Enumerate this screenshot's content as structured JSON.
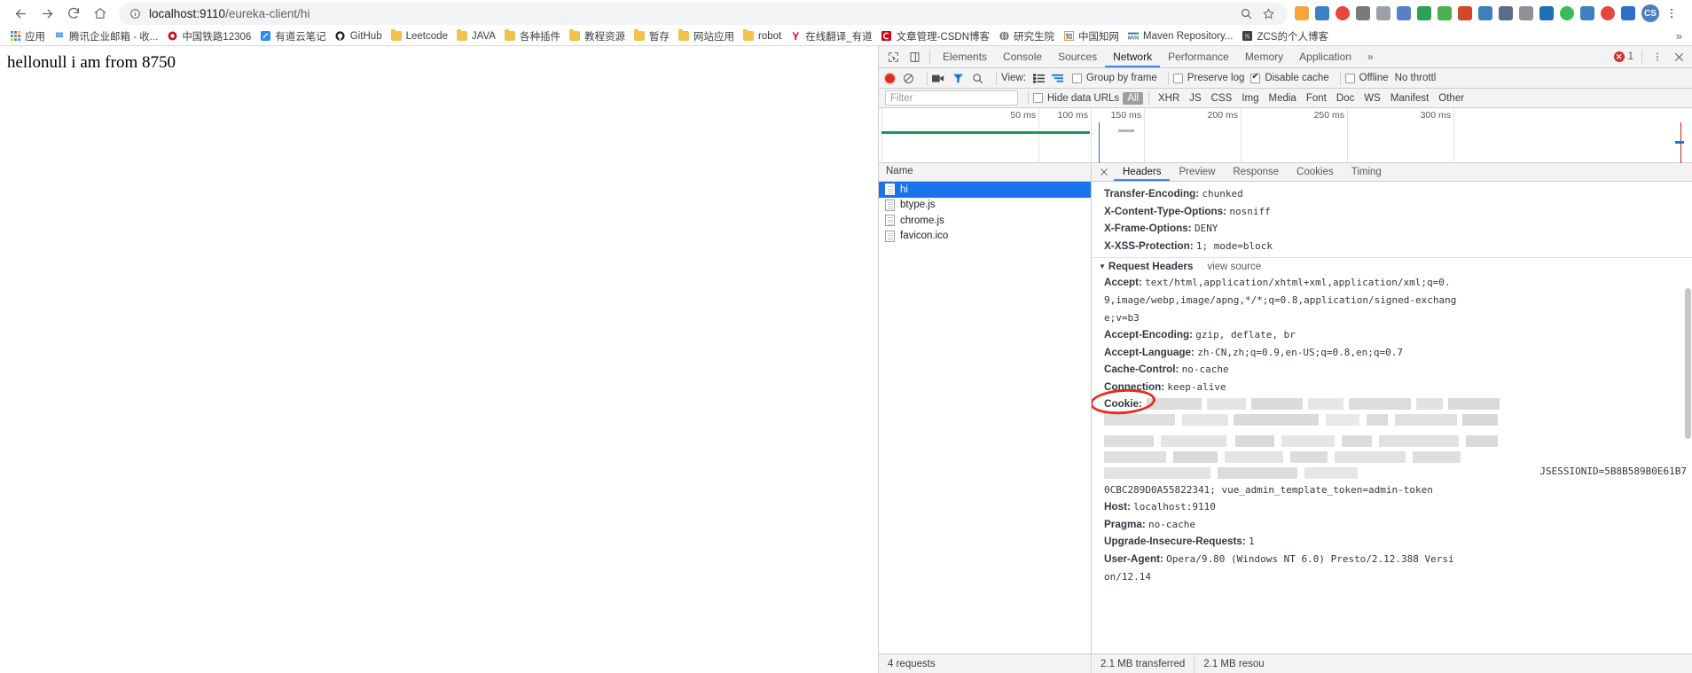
{
  "browser": {
    "nav": {
      "back": "back-arrow",
      "forward": "forward-arrow",
      "reload": "reload",
      "home": "home"
    },
    "omnibox": {
      "security_icon": "info-circle-icon",
      "url_host": "localhost:9110",
      "url_path": "/eureka-client/hi",
      "full_url": "localhost:9110/eureka-client/hi",
      "zoom_icon": "zoom-search-icon",
      "star_icon": "bookmark-star-icon"
    },
    "profile_initials": "CS",
    "bookmarks": [
      {
        "label": "应用",
        "icon": "apps-grid-icon",
        "color": "#4285f4"
      },
      {
        "label": "腾讯企业邮箱 - 收...",
        "icon": "mail-icon",
        "color": "#2a7fe0"
      },
      {
        "label": "中国铁路12306",
        "icon": "railway-icon",
        "color": "#c8102e"
      },
      {
        "label": "有道云笔记",
        "icon": "note-icon",
        "color": "#2d8cf0"
      },
      {
        "label": "GitHub",
        "icon": "github-icon",
        "color": "#1b1f23"
      },
      {
        "label": "Leetcode",
        "icon": "folder-icon",
        "color": "#f2c14e"
      },
      {
        "label": "JAVA",
        "icon": "folder-icon",
        "color": "#f2c14e"
      },
      {
        "label": "各种插件",
        "icon": "folder-icon",
        "color": "#f2c14e"
      },
      {
        "label": "教程资源",
        "icon": "folder-icon",
        "color": "#f2c14e"
      },
      {
        "label": "暂存",
        "icon": "folder-icon",
        "color": "#f2c14e"
      },
      {
        "label": "网站应用",
        "icon": "folder-icon",
        "color": "#f2c14e"
      },
      {
        "label": "robot",
        "icon": "folder-icon",
        "color": "#f2c14e"
      },
      {
        "label": "在线翻译_有道",
        "icon": "youdao-icon",
        "color": "#d0021b"
      },
      {
        "label": "文章管理-CSDN博客",
        "icon": "csdn-icon",
        "color": "#d0021b"
      },
      {
        "label": "研究生院",
        "icon": "globe-icon",
        "color": "#6b6b6b"
      },
      {
        "label": "中国知网",
        "icon": "cnki-icon",
        "color": "#e8881a"
      },
      {
        "label": "Maven Repository...",
        "icon": "maven-icon",
        "color": "#2d6ca2"
      },
      {
        "label": "ZCS的个人博客",
        "icon": "blog-icon",
        "color": "#3c4043"
      }
    ],
    "bookmarks_overflow": "»"
  },
  "page": {
    "body_text": "hellonull i am from 8750"
  },
  "devtools": {
    "panel_tabs": [
      {
        "label": "Elements",
        "active": false
      },
      {
        "label": "Console",
        "active": false
      },
      {
        "label": "Sources",
        "active": false
      },
      {
        "label": "Network",
        "active": true
      },
      {
        "label": "Performance",
        "active": false
      },
      {
        "label": "Memory",
        "active": false
      },
      {
        "label": "Application",
        "active": false
      }
    ],
    "more_tabs": "»",
    "error_count": "1",
    "menu_icon": "kebab-menu-icon",
    "close_icon": "close-icon",
    "inspect_icon": "inspect-element-icon",
    "device_icon": "device-toolbar-icon",
    "toolbar": {
      "record_icon": "record-icon",
      "clear_icon": "clear-icon",
      "camera_icon": "screenshot-camera-icon",
      "filter_icon": "filter-funnel-icon",
      "search_icon": "search-icon",
      "view_label": "View:",
      "view_list_icon": "view-list-icon",
      "view_waterfall_icon": "view-waterfall-icon",
      "group_by_frame": "Group by frame",
      "group_by_frame_checked": false,
      "preserve_log": "Preserve log",
      "preserve_log_checked": false,
      "disable_cache": "Disable cache",
      "disable_cache_checked": true,
      "offline": "Offline",
      "offline_checked": false,
      "throttling": "No throttl"
    },
    "filterbar": {
      "filter_placeholder": "Filter",
      "hide_data_urls": "Hide data URLs",
      "hide_data_urls_checked": false,
      "types": [
        "All",
        "XHR",
        "JS",
        "CSS",
        "Img",
        "Media",
        "Font",
        "Doc",
        "WS",
        "Manifest",
        "Other"
      ],
      "selected_type": "All"
    },
    "overview": {
      "ticks": [
        "50 ms",
        "100 ms",
        "150 ms",
        "200 ms",
        "250 ms",
        "300 ms"
      ]
    },
    "requests": {
      "column_header": "Name",
      "rows": [
        {
          "name": "hi",
          "selected": true
        },
        {
          "name": "btype.js",
          "selected": false
        },
        {
          "name": "chrome.js",
          "selected": false
        },
        {
          "name": "favicon.ico",
          "selected": false
        }
      ]
    },
    "detail": {
      "tabs": [
        {
          "label": "Headers",
          "active": true
        },
        {
          "label": "Preview",
          "active": false
        },
        {
          "label": "Response",
          "active": false
        },
        {
          "label": "Cookies",
          "active": false
        },
        {
          "label": "Timing",
          "active": false
        }
      ],
      "response_headers": [
        {
          "name": "Transfer-Encoding:",
          "value": "chunked"
        },
        {
          "name": "X-Content-Type-Options:",
          "value": "nosniff"
        },
        {
          "name": "X-Frame-Options:",
          "value": "DENY"
        },
        {
          "name": "X-XSS-Protection:",
          "value": "1; mode=block"
        }
      ],
      "request_headers_title": "Request Headers",
      "view_source": "view source",
      "request_headers": [
        {
          "name": "Accept:",
          "value": "text/html,application/xhtml+xml,application/xml;q=0."
        },
        {
          "name": "",
          "value": "9,image/webp,image/apng,*/*;q=0.8,application/signed-exchang"
        },
        {
          "name": "",
          "value": "e;v=b3"
        },
        {
          "name": "Accept-Encoding:",
          "value": "gzip, deflate, br"
        },
        {
          "name": "Accept-Language:",
          "value": "zh-CN,zh;q=0.9,en-US;q=0.8,en;q=0.7"
        },
        {
          "name": "Cache-Control:",
          "value": "no-cache"
        },
        {
          "name": "Connection:",
          "value": "keep-alive"
        }
      ],
      "cookie_label": "Cookie:",
      "cookie_redacted": true,
      "cookie_visible_fragment": "JSESSIONID=5B8B589B0E61B7",
      "cookie_tail": "0CBC289D0A55822341; vue_admin_template_token=admin-token",
      "trailing_headers": [
        {
          "name": "Host:",
          "value": "localhost:9110"
        },
        {
          "name": "Pragma:",
          "value": "no-cache"
        },
        {
          "name": "Upgrade-Insecure-Requests:",
          "value": "1"
        },
        {
          "name": "User-Agent:",
          "value": "Opera/9.80 (Windows NT 6.0) Presto/2.12.388 Versi"
        },
        {
          "name": "",
          "value": "on/12.14"
        }
      ],
      "annotation": "red-ellipse-around-cookie"
    },
    "status": {
      "requests": "4 requests",
      "transferred": "2.1 MB transferred",
      "resources": "2.1 MB resou"
    }
  }
}
